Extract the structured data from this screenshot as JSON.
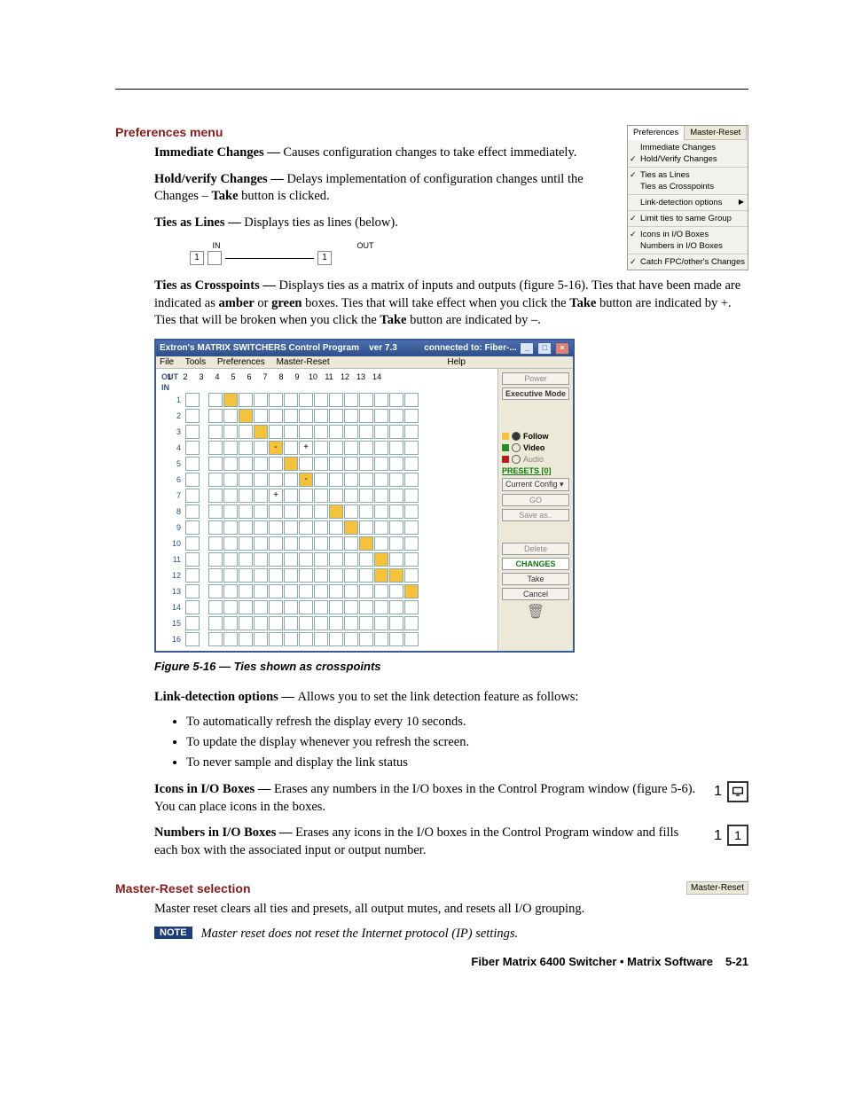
{
  "section_prefs_title": "Preferences menu",
  "prefs_menu": {
    "tabs": [
      "Preferences",
      "Master-Reset"
    ],
    "groups": [
      [
        {
          "label": "Immediate Changes",
          "checked": false
        },
        {
          "label": "Hold/Verify Changes",
          "checked": true
        }
      ],
      [
        {
          "label": "Ties as Lines",
          "checked": true
        },
        {
          "label": "Ties as Crosspoints",
          "checked": false
        }
      ],
      [
        {
          "label": "Link-detection options",
          "checked": false,
          "submenu": true
        }
      ],
      [
        {
          "label": "Limit ties to same Group",
          "checked": true
        }
      ],
      [
        {
          "label": "Icons in I/O Boxes",
          "checked": true
        },
        {
          "label": "Numbers in I/O Boxes",
          "checked": false
        }
      ],
      [
        {
          "label": "Catch FPC/other's Changes",
          "checked": true
        }
      ]
    ]
  },
  "immediate": {
    "label": "Immediate Changes — ",
    "text": "Causes configuration changes to take effect immediately."
  },
  "holdverify": {
    "label": "Hold/verify Changes — ",
    "text": "Delays implementation of configuration changes until the Changes – ",
    "take": "Take",
    "text2": " button is clicked."
  },
  "tieslines": {
    "label": "Ties as Lines — ",
    "text": "Displays ties as lines (below)."
  },
  "ties_diagram": {
    "in": "IN",
    "out": "OUT",
    "val": "1"
  },
  "tiescross": {
    "label": "Ties as Crosspoints — ",
    "text1": "Displays ties as a matrix of inputs and outputs (figure 5-16). Ties that have been made are indicated as ",
    "amber": "amber",
    "or": " or ",
    "green": "green",
    "text2": " boxes.  Ties that will take effect when you click the ",
    "take": "Take",
    "text3": " button are indicated by +.  Ties that will be broken when you click the ",
    "text4": " button are indicated by –."
  },
  "xp_window": {
    "title1": "Extron's MATRIX SWITCHERS Control Program",
    "title2": "ver 7.3",
    "title3": "connected to:  Fiber-...",
    "menu": [
      "File",
      "Tools",
      "Preferences",
      "Master-Reset",
      "Help"
    ],
    "out": "OUT",
    "in": "IN",
    "cols": [
      "1",
      "2",
      "3",
      "4",
      "5",
      "6",
      "7",
      "8",
      "9",
      "10",
      "11",
      "12",
      "13",
      "14"
    ],
    "rows": [
      "1",
      "2",
      "3",
      "4",
      "5",
      "6",
      "7",
      "8",
      "9",
      "10",
      "11",
      "12",
      "13",
      "14",
      "15",
      "16"
    ],
    "ties": [
      {
        "r": 1,
        "c": 2,
        "cls": "amber"
      },
      {
        "r": 2,
        "c": 3,
        "cls": "amber"
      },
      {
        "r": 3,
        "c": 4,
        "cls": "amber"
      },
      {
        "r": 4,
        "c": 5,
        "cls": "amber",
        "txt": "-"
      },
      {
        "r": 4,
        "c": 7,
        "txt": "+"
      },
      {
        "r": 5,
        "c": 6,
        "cls": "amber"
      },
      {
        "r": 6,
        "c": 7,
        "cls": "amber",
        "txt": "-"
      },
      {
        "r": 7,
        "c": 5,
        "txt": "+"
      },
      {
        "r": 8,
        "c": 9,
        "cls": "amber"
      },
      {
        "r": 9,
        "c": 10,
        "cls": "amber"
      },
      {
        "r": 10,
        "c": 11,
        "cls": "amber"
      },
      {
        "r": 11,
        "c": 12,
        "cls": "amber"
      },
      {
        "r": 12,
        "c": 12,
        "cls": "amber"
      },
      {
        "r": 12,
        "c": 13,
        "cls": "amber"
      },
      {
        "r": 13,
        "c": 14,
        "cls": "amber"
      }
    ],
    "side": {
      "power": "Power",
      "exec": "Executive Mode",
      "follow": "Follow",
      "video": "Video",
      "audio": "Audio",
      "presets": "PRESETS [0]",
      "current": "Current Config",
      "go": "GO",
      "saveas": "Save as..",
      "delete": "Delete",
      "changes": "CHANGES",
      "take": "Take",
      "cancel": "Cancel"
    }
  },
  "fig_caption": "Figure 5-16 — Ties shown as crosspoints",
  "linkdet": {
    "label": "Link-detection options — ",
    "text": "Allows you to set the link detection feature as follows:",
    "opts": [
      "To automatically refresh the display every 10 seconds.",
      "To update the display whenever you refresh the screen.",
      "To never sample and display the link status"
    ]
  },
  "iconsio": {
    "label": "Icons in I/O Boxes — ",
    "text": "Erases any numbers in the I/O boxes in the Control Program window (figure 5-6).  You can place icons in the boxes.",
    "num": "1"
  },
  "numbersio": {
    "label": "Numbers in I/O Boxes — ",
    "text": "Erases any icons in the I/O boxes in the Control Program window and fills each box with the associated input or output number.",
    "num1": "1",
    "num2": "1"
  },
  "section_mr_title": "Master-Reset selection",
  "mr_menu": "Master-Reset",
  "mr_text": "Master reset clears all ties and presets, all output mutes, and resets all I/O grouping.",
  "note": {
    "badge": "NOTE",
    "text": "Master reset does not reset the Internet protocol (IP) settings."
  },
  "footer": {
    "text": "Fiber Matrix 6400 Switcher • Matrix Software",
    "page": "5-21"
  }
}
